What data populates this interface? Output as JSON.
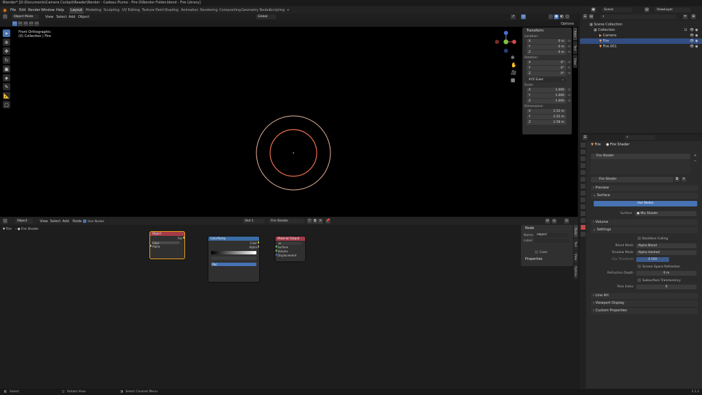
{
  "title": "Blender* [D:\\Documents\\Camera Cockpit\\Reader\\Render - Cadeau Plume - Fire D\\Render Folder.blend - Fire Library]",
  "menu": [
    "File",
    "Edit",
    "Render",
    "Window",
    "Help"
  ],
  "workspaces": [
    "Layout",
    "Modeling",
    "Sculpting",
    "UV Editing",
    "Texture Paint",
    "Shading",
    "Animation",
    "Rendering",
    "Compositing",
    "Geometry Nodes",
    "Scripting",
    "+"
  ],
  "scene": {
    "label": "Scene",
    "view_layer": "ViewLayer"
  },
  "viewport": {
    "mode": "Object Mode",
    "menus": [
      "View",
      "Select",
      "Add",
      "Object"
    ],
    "transform_orientation": "Global",
    "view_name": "Front Orthographic",
    "collection_info": "(0) Collection | Fire",
    "options_label": "Options"
  },
  "npanel": {
    "title": "Transform",
    "location_label": "Location:",
    "location": [
      {
        "axis": "X",
        "value": "0 m"
      },
      {
        "axis": "Y",
        "value": "0 m"
      },
      {
        "axis": "Z",
        "value": "0 m"
      }
    ],
    "rotation_label": "Rotation:",
    "rotation": [
      {
        "axis": "X",
        "value": "0°"
      },
      {
        "axis": "Y",
        "value": "0°"
      },
      {
        "axis": "Z",
        "value": "0°"
      }
    ],
    "rotation_mode": "XYZ Euler",
    "scale_label": "Scale:",
    "scale": [
      {
        "axis": "X",
        "value": "1.000"
      },
      {
        "axis": "Y",
        "value": "1.000"
      },
      {
        "axis": "Z",
        "value": "1.000"
      }
    ],
    "dimensions_label": "Dimensions:",
    "dimensions": [
      {
        "axis": "X",
        "value": "2.52 m"
      },
      {
        "axis": "Y",
        "value": "2.52 m"
      },
      {
        "axis": "Z",
        "value": "2.58 m"
      }
    ],
    "tabs": [
      "Item",
      "Tool",
      "View"
    ]
  },
  "outliner": {
    "search_placeholder": "",
    "rows": [
      {
        "label": "Scene Collection",
        "indent": 0,
        "selected": false
      },
      {
        "label": "Collection",
        "indent": 1,
        "selected": false
      },
      {
        "label": "Camera",
        "indent": 2,
        "selected": false
      },
      {
        "label": "Fire",
        "indent": 2,
        "selected": true
      },
      {
        "label": "Fire.001",
        "indent": 2,
        "selected": false
      }
    ]
  },
  "properties": {
    "breadcrumb": [
      "Fire",
      "Fire Shader"
    ],
    "slot": "Fire Shader",
    "material": "Fire Shader",
    "sections": {
      "preview": "Preview",
      "surface": "Surface",
      "volume": "Volume",
      "settings": "Settings",
      "line_art": "Line Art",
      "viewport_display": "Viewport Display",
      "custom_properties": "Custom Properties"
    },
    "surface_button": "Use Nodes",
    "surface_label": "Surface",
    "surface_value": "Mix Shader",
    "backface_culling": "Backface Culling",
    "blend_mode_label": "Blend Mode",
    "blend_mode": "Alpha Blend",
    "shadow_mode_label": "Shadow Mode",
    "shadow_mode": "Alpha Hashed",
    "clip_threshold_label": "Clip Threshold",
    "clip_threshold": "0.500",
    "screen_space_refraction": "Screen Space Refraction",
    "refraction_depth_label": "Refraction Depth",
    "refraction_depth": "0 m",
    "subsurface_translucency": "Subsurface Translucency",
    "pass_index_label": "Pass Index",
    "pass_index": "0"
  },
  "node_editor": {
    "editor_type": "Object",
    "menus": [
      "View",
      "Select",
      "Add",
      "Node"
    ],
    "use_nodes": "Use Nodes",
    "slot": "Slot 1",
    "material": "Fire Shader",
    "breadcrumb": [
      "Fire",
      "Fire Shader"
    ],
    "nodes": [
      {
        "title": "Object",
        "color": "#a33a48",
        "lines": [
          "Fac",
          "Color",
          "Alpha"
        ]
      },
      {
        "title": "ColorRamp",
        "color": "#3b6da5",
        "lines": [
          "Color",
          "Alpha",
          "Fac"
        ]
      },
      {
        "title": "Material Output",
        "color": "#a33a48",
        "lines": [
          "All",
          "Surface",
          "Volume",
          "Displacement"
        ]
      }
    ],
    "sidebar": {
      "title": "Node",
      "name_label": "Name:",
      "name_value": "Object",
      "label_label": "Label:",
      "label_value": "",
      "color_label": "Color",
      "properties_title": "Properties"
    },
    "tabs": [
      "Node",
      "Tool",
      "View",
      "Options"
    ]
  },
  "status": {
    "left": "Select",
    "middle": "Rotate View",
    "right": "Select Context Menu",
    "version": "3.1.2"
  },
  "colors": {
    "accent": "#4772b3",
    "ring_outer": "#f0b9a0",
    "ring_inner": "#f07050",
    "selected_node_border": "#e9a31b"
  }
}
